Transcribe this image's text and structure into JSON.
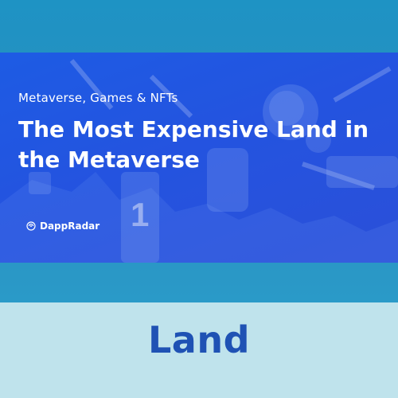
{
  "banner": {
    "subtitle": "Metaverse, Games & NFTs",
    "title": "The Most Expensive Land in the Metaverse",
    "brand_name": "DappRadar",
    "brand_icon": "dappradar-logo-icon",
    "jersey_number": "1"
  },
  "label": {
    "text": "Land"
  },
  "colors": {
    "banner_blue": "#2454e0",
    "top_band": "#2a8fbf",
    "bottom_band": "#bfe3ec",
    "label_text": "#1f52b4"
  }
}
